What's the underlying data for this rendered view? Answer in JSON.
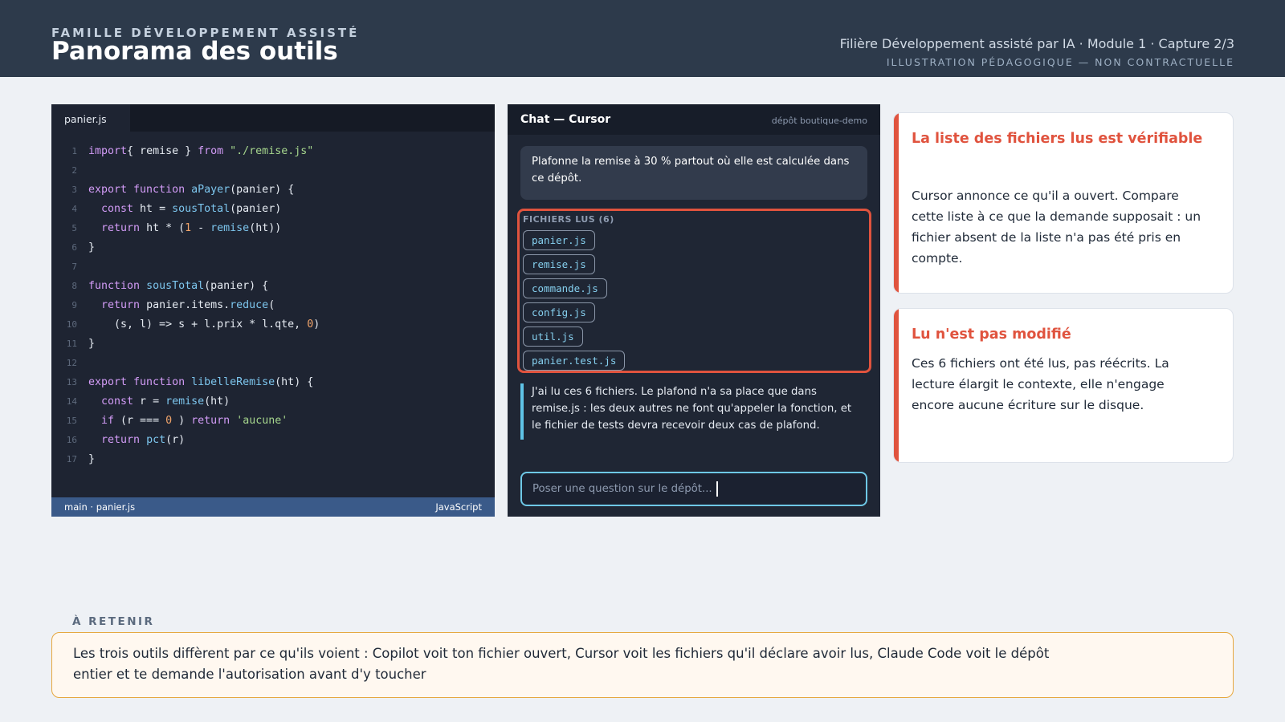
{
  "header": {
    "family": "FAMILLE DÉVELOPPEMENT ASSISTÉ",
    "title": "Panorama des outils",
    "filiere": "Filière Développement assisté par IA · Module 1 · Capture 2/3",
    "notice": "ILLUSTRATION PÉDAGOGIQUE — NON CONTRACTUELLE"
  },
  "editor": {
    "tab": "panier.js",
    "code": [
      {
        "n": "1",
        "t": [
          [
            "kw",
            "import"
          ],
          [
            "",
            "{ remise } "
          ],
          [
            "kw",
            "from"
          ],
          [
            "",
            ""
          ],
          [
            "str",
            "\"./remise.js\""
          ]
        ]
      },
      {
        "n": "2",
        "t": []
      },
      {
        "n": "3",
        "t": [
          [
            "kw",
            "export function "
          ],
          [
            "fn",
            "aPayer"
          ],
          [
            "",
            "(panier) {"
          ]
        ]
      },
      {
        "n": "4",
        "t": [
          [
            "",
            "  "
          ],
          [
            "kw",
            "const"
          ],
          [
            "",
            " ht = "
          ],
          [
            "fn",
            "sousTotal"
          ],
          [
            "",
            "(panier)"
          ]
        ]
      },
      {
        "n": "5",
        "t": [
          [
            "",
            "  "
          ],
          [
            "kw",
            "return"
          ],
          [
            "",
            " ht * ("
          ],
          [
            "num",
            "1"
          ],
          [
            "",
            " - "
          ],
          [
            "fn",
            "remise"
          ],
          [
            "",
            "(ht))"
          ]
        ]
      },
      {
        "n": "6",
        "t": [
          [
            "",
            "}"
          ]
        ]
      },
      {
        "n": "7",
        "t": []
      },
      {
        "n": "8",
        "t": [
          [
            "kw",
            "function "
          ],
          [
            "fn",
            "sousTotal"
          ],
          [
            "",
            "(panier) {"
          ]
        ]
      },
      {
        "n": "9",
        "t": [
          [
            "",
            "  "
          ],
          [
            "kw",
            "return"
          ],
          [
            "",
            " panier.items."
          ],
          [
            "fn",
            "reduce"
          ],
          [
            "",
            "("
          ]
        ]
      },
      {
        "n": "10",
        "t": [
          [
            "",
            "    (s, l) => s + l.prix * l.qte, "
          ],
          [
            "num",
            "0"
          ],
          [
            "",
            ")"
          ]
        ]
      },
      {
        "n": "11",
        "t": [
          [
            "",
            "}"
          ]
        ]
      },
      {
        "n": "12",
        "t": []
      },
      {
        "n": "13",
        "t": [
          [
            "kw",
            "export function "
          ],
          [
            "fn",
            "libelleRemise"
          ],
          [
            "",
            "(ht) {"
          ]
        ]
      },
      {
        "n": "14",
        "t": [
          [
            "",
            "  "
          ],
          [
            "kw",
            "const"
          ],
          [
            "",
            " r = "
          ],
          [
            "fn",
            "remise"
          ],
          [
            "",
            "(ht)"
          ]
        ]
      },
      {
        "n": "15",
        "t": [
          [
            "",
            "  "
          ],
          [
            "kw",
            "if"
          ],
          [
            "",
            " (r === "
          ],
          [
            "num",
            "0"
          ],
          [
            "",
            " ) "
          ],
          [
            "kw",
            "return"
          ],
          [
            "",
            " "
          ],
          [
            "str",
            "'aucune'"
          ]
        ]
      },
      {
        "n": "16",
        "t": [
          [
            "",
            "  "
          ],
          [
            "kw",
            "return"
          ],
          [
            "",
            " "
          ],
          [
            "fn",
            "pct"
          ],
          [
            "",
            "(r)"
          ]
        ]
      },
      {
        "n": "17",
        "t": [
          [
            "",
            "}"
          ]
        ]
      }
    ],
    "status_left": "main · panier.js",
    "status_right": "JavaScript"
  },
  "chat": {
    "title": "Chat — Cursor",
    "repo": "dépôt boutique-demo",
    "user_message": "Plafonne la remise à 30 % partout où elle est calculée dans ce dépôt.",
    "files_label": "FICHIERS LUS (6)",
    "files": [
      "panier.js",
      "remise.js",
      "commande.js",
      "config.js",
      "util.js",
      "panier.test.js"
    ],
    "reply": "J'ai lu ces 6 fichiers. Le plafond n'a sa place que dans remise.js : les deux autres ne font qu'appeler la fonction, et le fichier de tests devra recevoir deux cas de plafond.",
    "input_placeholder": "Poser une question sur le dépôt..."
  },
  "cards": [
    {
      "title": "La liste des fichiers lus est vérifiable",
      "body": "Cursor annonce ce qu'il a ouvert. Compare cette liste à ce que la demande supposait : un fichier absent de la liste n'a pas été pris en compte."
    },
    {
      "title": "Lu n'est pas modifié",
      "body": "Ces 6 fichiers ont été lus, pas réécrits. La lecture élargit le contexte, elle n'engage encore aucune écriture sur le disque."
    }
  ],
  "retenir": {
    "label": "À RETENIR",
    "text": "Les trois outils diffèrent par ce qu'ils voient : Copilot voit ton fichier ouvert, Cursor voit les fichiers qu'il déclare avoir lus, Claude Code voit le dépôt entier et te demande l'autorisation avant d'y toucher"
  },
  "colors": {
    "header_bg": "#2d3a4b",
    "accent_red": "#e0533e",
    "accent_blue": "#5fc3e6",
    "retenir_border": "#e6a83f"
  }
}
